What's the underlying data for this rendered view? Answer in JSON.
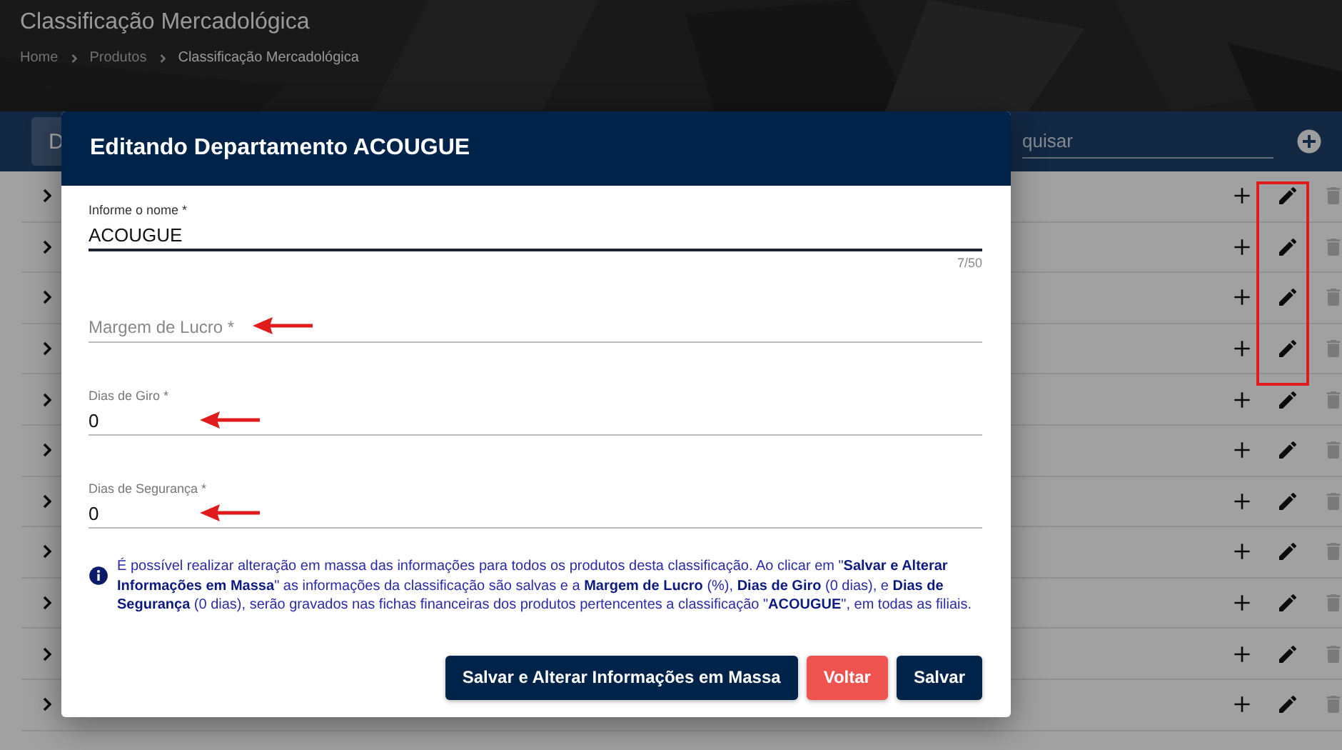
{
  "page": {
    "title": "Classificação Mercadológica",
    "breadcrumb": [
      "Home",
      "Produtos",
      "Classificação Mercadológica"
    ]
  },
  "toolbar": {
    "tab_label": "D",
    "search_placeholder": "quisar"
  },
  "rows": [
    {
      "highlighted": true
    },
    {
      "highlighted": true
    },
    {
      "highlighted": true
    },
    {
      "highlighted": true
    },
    {
      "highlighted": false
    },
    {
      "highlighted": false
    },
    {
      "highlighted": false
    },
    {
      "highlighted": false
    },
    {
      "highlighted": false
    },
    {
      "highlighted": false
    },
    {
      "highlighted": false
    }
  ],
  "dialog": {
    "title": "Editando Departamento ACOUGUE",
    "fields": [
      {
        "label": "Informe o nome *",
        "value": "ACOUGUE",
        "counter": "7/50",
        "focused": true,
        "arrow": false
      },
      {
        "placeholder": "Margem de Lucro *",
        "focused": false,
        "arrow": true
      },
      {
        "label": "Dias de Giro *",
        "value": "0",
        "focused": false,
        "arrow": true
      },
      {
        "label": "Dias de Segurança *",
        "value": "0",
        "focused": false,
        "arrow": true
      }
    ],
    "info": "É possível realizar alteração em massa das informações para todos os produtos desta classificação. Ao clicar em \"**Salvar e Alterar Informações em Massa**\" as informações da classificação são salvas e a **Margem de Lucro** (%), **Dias de Giro** (0 dias), e **Dias de Segurança** (0 dias), serão gravados nas fichas financeiras dos produtos pertencentes a classificação \"**ACOUGUE**\", em todas as filiais.",
    "buttons": [
      {
        "label": "Salvar e Alterar Informações em Massa",
        "kind": "primary"
      },
      {
        "label": "Voltar",
        "kind": "danger"
      },
      {
        "label": "Salvar",
        "kind": "primary"
      }
    ]
  }
}
